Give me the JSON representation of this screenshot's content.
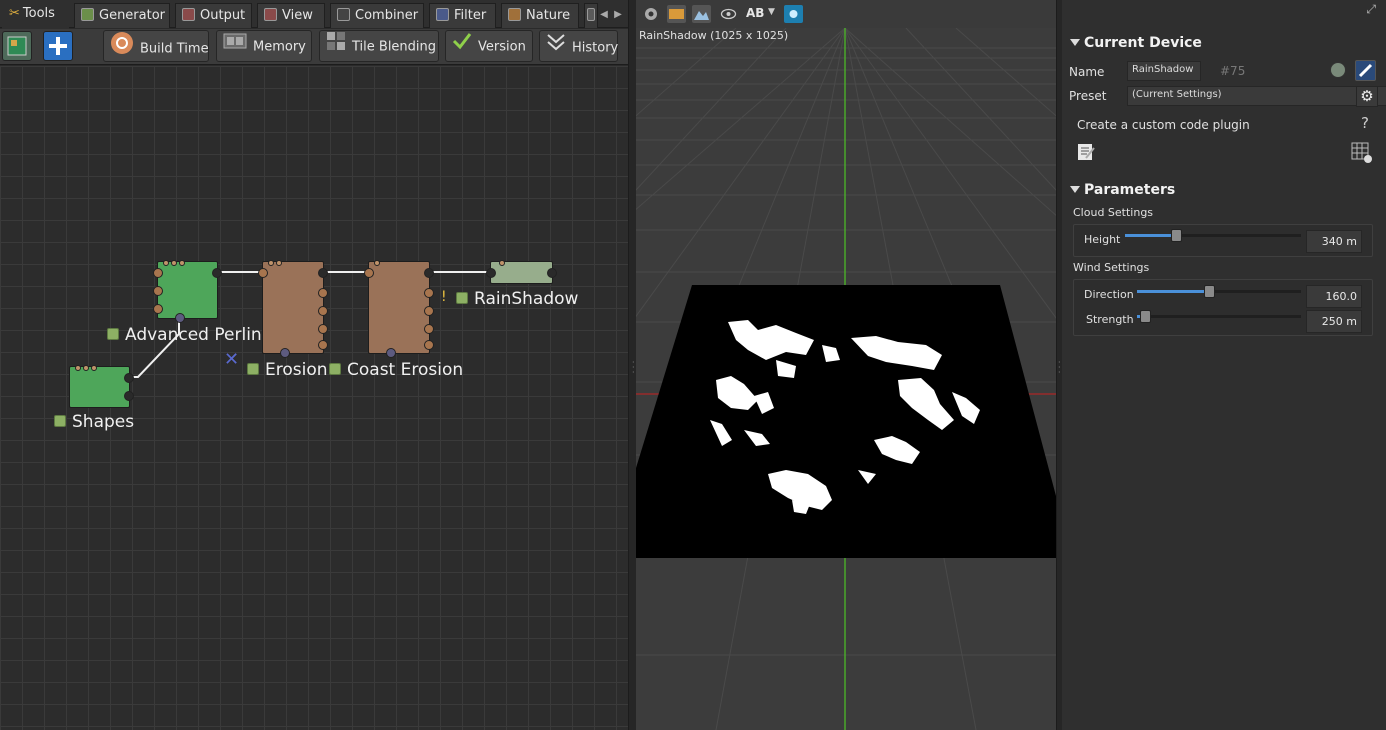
{
  "tabs": [
    {
      "label": "Tools",
      "icon": "tools-icon"
    },
    {
      "label": "Generator",
      "icon": "generator-icon"
    },
    {
      "label": "Output",
      "icon": "output-icon"
    },
    {
      "label": "View",
      "icon": "view-icon"
    },
    {
      "label": "Combiner",
      "icon": "combiner-icon"
    },
    {
      "label": "Filter",
      "icon": "filter-icon"
    },
    {
      "label": "Nature",
      "icon": "nature-icon"
    }
  ],
  "toolbar": {
    "build_time": "Build Time",
    "memory": "Memory",
    "tile_blending": "Tile Blending",
    "version": "Version",
    "history": "History"
  },
  "graph": {
    "nodes": {
      "advanced_perlin": "Advanced Perlin",
      "shapes": "Shapes",
      "erosion": "Erosion",
      "coast_erosion": "Coast Erosion",
      "rainshadow": "RainShadow",
      "warning": "!"
    }
  },
  "viewport": {
    "title": "RainShadow (1025 x 1025)",
    "ab_label": "AB"
  },
  "device": {
    "section_title": "Current Device",
    "name_label": "Name",
    "name_value": "RainShadow",
    "id": "#75",
    "preset_label": "Preset",
    "preset_value": "(Current Settings)",
    "custom_plugin": "Create a custom code plugin",
    "help": "?"
  },
  "parameters": {
    "section_title": "Parameters",
    "cloud_group": "Cloud Settings",
    "height_label": "Height",
    "height_value": "340 m",
    "height_level": 0.29,
    "wind_group": "Wind Settings",
    "direction_label": "Direction",
    "direction_value": "160.0",
    "direction_level": 0.44,
    "strength_label": "Strength",
    "strength_value": "250 m",
    "strength_level": 0.05
  },
  "colors": {
    "accent": "#4a90d9",
    "node_green": "#4ea65a",
    "node_brown": "#9a7258",
    "node_pale": "#97ad8c"
  }
}
